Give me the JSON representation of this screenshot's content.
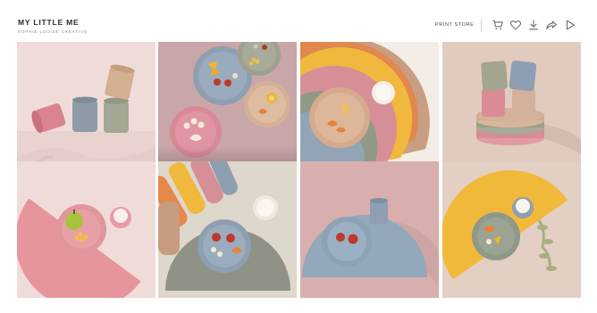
{
  "header": {
    "title": "MY LITTLE ME",
    "subtitle": "SOPHIE LOUISE CREATIVE",
    "print_store": "PRINT STORE",
    "icons": [
      "cart-icon",
      "heart-icon",
      "download-icon",
      "share-icon",
      "play-icon"
    ]
  },
  "gallery": {
    "photos": [
      {
        "subject": "cups-on-pink"
      },
      {
        "subject": "plates-with-fruit-overhead"
      },
      {
        "subject": "stacked-placemats"
      },
      {
        "subject": "stacked-cups-and-plates"
      },
      {
        "subject": "pink-placemat-with-pear"
      },
      {
        "subject": "green-placemat-with-strawberries"
      },
      {
        "subject": "blue-placemat-with-strawberries"
      },
      {
        "subject": "yellow-placemat-with-orange"
      }
    ],
    "hover_overlay_icons": [
      "bag-icon",
      "heart-icon",
      "download-icon",
      "share-icon"
    ]
  },
  "colors": {
    "pink": "#d98f98",
    "sage": "#8f9487",
    "blue": "#8e9fb1",
    "yellow": "#f1ba3a",
    "orange": "#e18a45",
    "tan": "#d0b093"
  }
}
